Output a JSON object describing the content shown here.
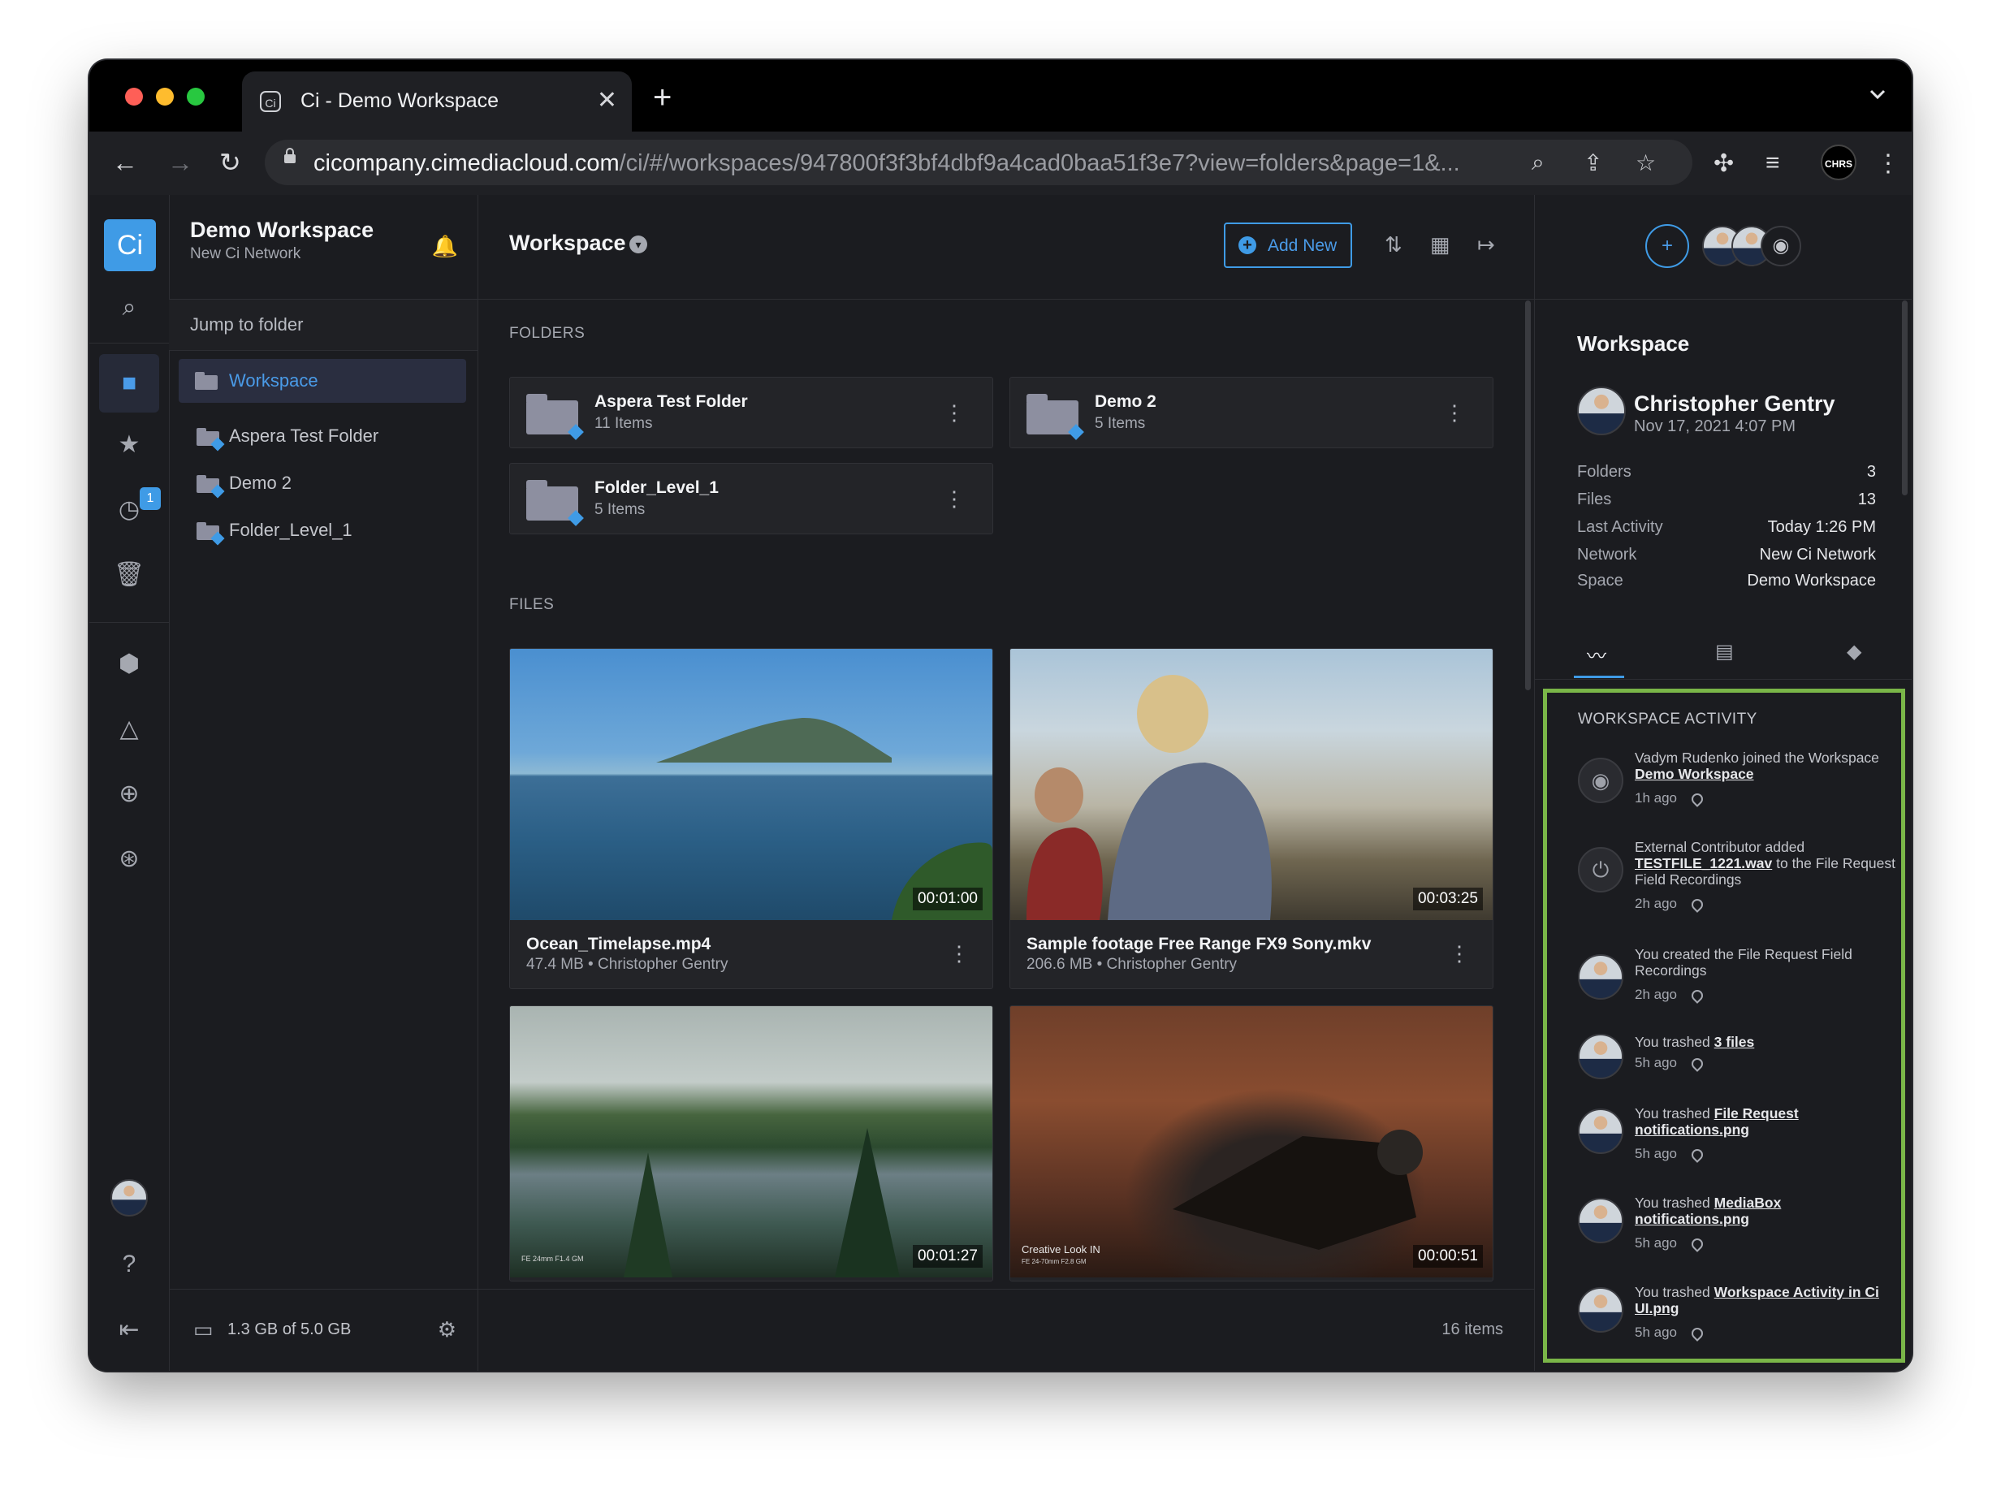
{
  "browser": {
    "tab_title": "Ci - Demo Workspace",
    "tab_favicon": "Ci",
    "url_host": "cicompany.cimediacloud.com",
    "url_path": "/ci/#/workspaces/947800f3f3bf4dbf9a4cad0baa51f3e7?view=folders&page=1&...",
    "profile_label": "CHRS",
    "traffic_lights": [
      "#fe5f57",
      "#febc2e",
      "#28c840"
    ]
  },
  "rail": {
    "logo": "Ci",
    "recent_badge": "1"
  },
  "sidebar": {
    "title": "Demo Workspace",
    "subtitle": "New Ci Network",
    "jump_placeholder": "Jump to folder",
    "active": "Workspace",
    "folders": [
      "Aspera Test Folder",
      "Demo 2",
      "Folder_Level_1"
    ],
    "storage": "1.3 GB of 5.0 GB"
  },
  "main": {
    "title": "Workspace",
    "add_new": "Add New",
    "folders_label": "FOLDERS",
    "files_label": "FILES",
    "folders": [
      {
        "name": "Aspera Test Folder",
        "count": "11 Items"
      },
      {
        "name": "Demo 2",
        "count": "5 Items"
      },
      {
        "name": "Folder_Level_1",
        "count": "5 Items"
      }
    ],
    "files": [
      {
        "name": "Ocean_Timelapse.mp4",
        "meta": "47.4 MB • Christopher Gentry",
        "duration": "00:01:00"
      },
      {
        "name": "Sample footage Free Range FX9 Sony.mkv",
        "meta": "206.6 MB • Christopher Gentry",
        "duration": "00:03:25"
      },
      {
        "name": "",
        "meta": "",
        "duration": "00:01:27",
        "overlay": "FE 24mm F1.4 GM"
      },
      {
        "name": "",
        "meta": "",
        "duration": "00:00:51",
        "overlay": "Creative Look IN",
        "overlay2": "FE 24-70mm F2.8 GM"
      }
    ],
    "item_count": "16 items"
  },
  "details": {
    "title": "Workspace",
    "owner": "Christopher Gentry",
    "created": "Nov 17, 2021 4:07 PM",
    "rows": [
      {
        "k": "Folders",
        "v": "3"
      },
      {
        "k": "Files",
        "v": "13"
      },
      {
        "k": "Last Activity",
        "v": "Today 1:26 PM"
      },
      {
        "k": "Network",
        "v": "New Ci Network"
      },
      {
        "k": "Space",
        "v": "Demo Workspace"
      }
    ],
    "activity_title": "WORKSPACE ACTIVITY",
    "activity": [
      {
        "pre": "Vadym Rudenko joined the Workspace ",
        "link": "Demo Workspace",
        "post": "",
        "time": "1h ago",
        "icon": "ci-network-icon"
      },
      {
        "pre": "External Contributor added ",
        "link": "TESTFILE_1221.wav",
        "post": " to the File Request Field Recordings",
        "time": "2h ago",
        "icon": "upload-icon"
      },
      {
        "pre": "You created the File Request Field Recordings",
        "link": "",
        "post": "",
        "time": "2h ago",
        "icon": "avatar"
      },
      {
        "pre": "You trashed ",
        "link": "3 files",
        "post": "",
        "time": "5h ago",
        "icon": "avatar"
      },
      {
        "pre": "You trashed ",
        "link": "File Request notifications.png",
        "post": "",
        "time": "5h ago",
        "icon": "avatar"
      },
      {
        "pre": "You trashed ",
        "link": "MediaBox notifications.png",
        "post": "",
        "time": "5h ago",
        "icon": "avatar"
      },
      {
        "pre": "You trashed ",
        "link": "Workspace Activity in Ci UI.png",
        "post": "",
        "time": "5h ago",
        "icon": "avatar"
      }
    ],
    "highlight_color": "#7ab648",
    "accent_color": "#3f9be6"
  }
}
